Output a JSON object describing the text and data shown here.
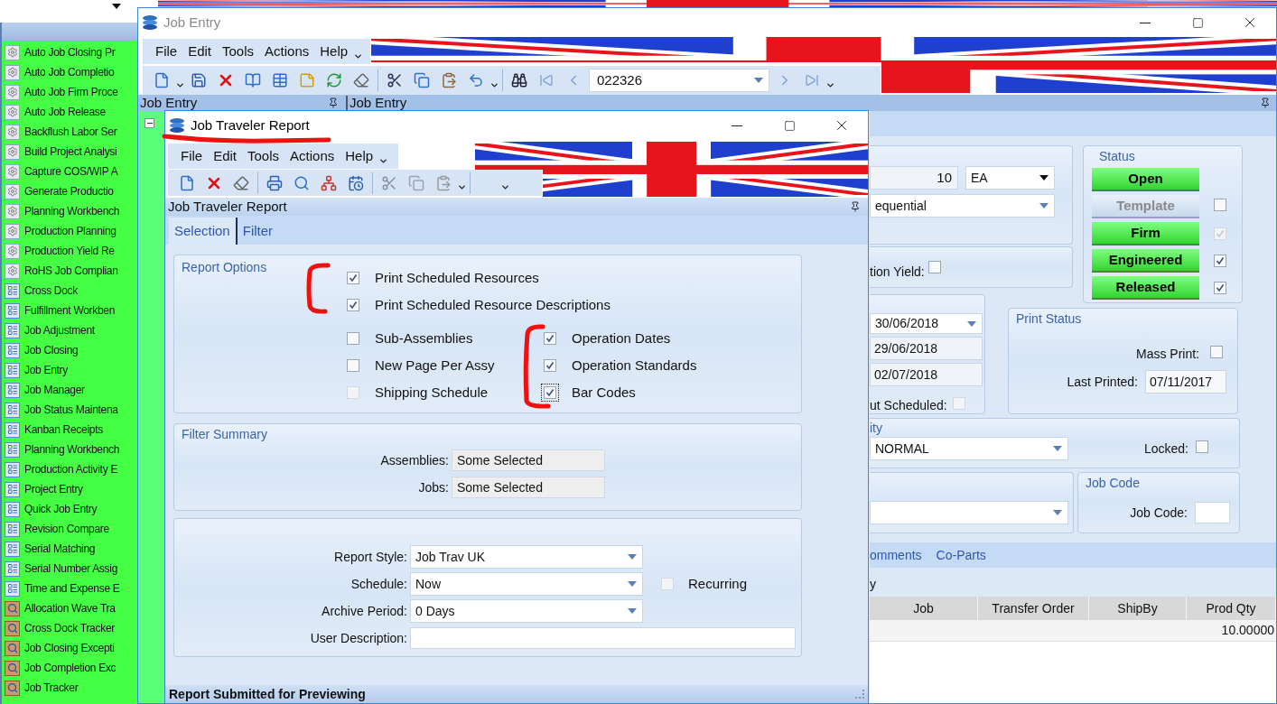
{
  "sidebar": {
    "items": [
      {
        "label": "Auto Job Closing Pr",
        "kind": "process"
      },
      {
        "label": "Auto Job Completio",
        "kind": "process"
      },
      {
        "label": "Auto Job Firm Proce",
        "kind": "process"
      },
      {
        "label": "Auto Job Release",
        "kind": "process"
      },
      {
        "label": "Backflush Labor Ser",
        "kind": "process"
      },
      {
        "label": "Build Project Analysi",
        "kind": "process"
      },
      {
        "label": "Capture COS/WIP A",
        "kind": "process"
      },
      {
        "label": "Generate Productio",
        "kind": "process"
      },
      {
        "label": "Planning Workbench",
        "kind": "process"
      },
      {
        "label": "Production Planning",
        "kind": "process"
      },
      {
        "label": "Production Yield Re",
        "kind": "process"
      },
      {
        "label": "RoHS Job Complian",
        "kind": "process"
      },
      {
        "label": "Cross Dock",
        "kind": "entry"
      },
      {
        "label": "Fulfillment Workben",
        "kind": "entry"
      },
      {
        "label": "Job Adjustment",
        "kind": "entry"
      },
      {
        "label": "Job Closing",
        "kind": "entry"
      },
      {
        "label": "Job Entry",
        "kind": "entry"
      },
      {
        "label": "Job Manager",
        "kind": "entry"
      },
      {
        "label": "Job Status Maintena",
        "kind": "entry"
      },
      {
        "label": "Kanban Receipts",
        "kind": "entry"
      },
      {
        "label": "Planning Workbench",
        "kind": "entry"
      },
      {
        "label": "Production Activity E",
        "kind": "entry"
      },
      {
        "label": "Project Entry",
        "kind": "entry"
      },
      {
        "label": "Quick Job Entry",
        "kind": "entry"
      },
      {
        "label": "Revision Compare",
        "kind": "entry"
      },
      {
        "label": "Serial Matching",
        "kind": "entry"
      },
      {
        "label": "Serial Number Assig",
        "kind": "entry"
      },
      {
        "label": "Time and Expense E",
        "kind": "entry"
      },
      {
        "label": "Allocation Wave Tra",
        "kind": "tracker"
      },
      {
        "label": "Cross Dock Tracker",
        "kind": "tracker"
      },
      {
        "label": "Job Closing Excepti",
        "kind": "tracker"
      },
      {
        "label": "Job Completion Exc",
        "kind": "tracker"
      },
      {
        "label": "Job Tracker",
        "kind": "tracker"
      }
    ]
  },
  "job_entry": {
    "title": "Job Entry",
    "menu": [
      "File",
      "Edit",
      "Tools",
      "Actions",
      "Help"
    ],
    "job_number": "022326",
    "pane_headers": [
      "Job Entry",
      "Job Entry"
    ],
    "quantity": "10",
    "uom": "EA",
    "scheduling": "equential",
    "yield": {
      "label": "tion Yield:",
      "checked": false
    },
    "dates": [
      "30/06/2018",
      "29/06/2018",
      "02/07/2018"
    ],
    "cut_scheduled": {
      "label": "ut Scheduled:",
      "checked": false,
      "disabled": true
    },
    "status": {
      "title": "Status",
      "buttons": [
        {
          "label": "Open",
          "active": true
        },
        {
          "label": "Template",
          "active": false,
          "checkbox": {
            "checked": false,
            "disabled": false
          }
        },
        {
          "label": "Firm",
          "active": true,
          "checkbox": {
            "checked": true,
            "disabled": true
          }
        },
        {
          "label": "Engineered",
          "active": true,
          "checkbox": {
            "checked": true,
            "disabled": false
          }
        },
        {
          "label": "Released",
          "active": true,
          "checkbox": {
            "checked": true,
            "disabled": false
          }
        }
      ]
    },
    "print_status": {
      "title": "Print Status",
      "mass_print": {
        "label": "Mass Print:",
        "checked": false
      },
      "last_printed_label": "Last Printed:",
      "last_printed": "07/11/2017"
    },
    "priority": {
      "title": "ity",
      "value": "NORMAL",
      "locked": {
        "label": "Locked:",
        "checked": false
      }
    },
    "job_code": {
      "title": "Job Code",
      "label": "Job Code:"
    },
    "tabs": [
      {
        "label": "omments",
        "selected": false
      },
      {
        "label": "Co-Parts",
        "selected": false
      }
    ],
    "grid": {
      "title": "y",
      "columns": [
        "Job",
        "Transfer Order",
        "ShipBy",
        "Prod Qty"
      ],
      "rows": [
        {
          "prod_qty": "10.00000"
        }
      ]
    }
  },
  "job_traveler": {
    "title": "Job Traveler Report",
    "menu": [
      "File",
      "Edit",
      "Tools",
      "Actions",
      "Help"
    ],
    "header": "Job Traveler Report",
    "tabs": [
      {
        "label": "Selection",
        "selected": true
      },
      {
        "label": "Filter",
        "selected": false
      }
    ],
    "report_options": {
      "title": "Report Options",
      "upper": [
        {
          "label": "Print Scheduled Resources",
          "checked": true,
          "disabled": false,
          "focused": false
        },
        {
          "label": "Print Scheduled Resource Descriptions",
          "checked": true,
          "disabled": false,
          "focused": false
        }
      ],
      "left": [
        {
          "label": "Sub-Assemblies",
          "checked": false,
          "disabled": false,
          "focused": false
        },
        {
          "label": "New Page Per Assy",
          "checked": false,
          "disabled": false,
          "focused": false
        },
        {
          "label": "Shipping Schedule",
          "checked": false,
          "disabled": true,
          "focused": false
        }
      ],
      "right": [
        {
          "label": "Operation Dates",
          "checked": true,
          "disabled": false,
          "focused": false
        },
        {
          "label": "Operation Standards",
          "checked": true,
          "disabled": false,
          "focused": false
        },
        {
          "label": "Bar Codes",
          "checked": true,
          "disabled": false,
          "focused": true
        }
      ]
    },
    "filter_summary": {
      "title": "Filter Summary",
      "fields": [
        {
          "label": "Assemblies:",
          "value": "Some Selected"
        },
        {
          "label": "Jobs:",
          "value": "Some Selected"
        }
      ]
    },
    "schedule": {
      "fields": [
        {
          "label": "Report Style:",
          "value": "Job Trav UK",
          "kind": "dropdown"
        },
        {
          "label": "Schedule:",
          "value": "Now",
          "kind": "dropdown"
        },
        {
          "label": "Archive Period:",
          "value": "0 Days",
          "kind": "dropdown"
        },
        {
          "label": "User Description:",
          "kind": "text"
        }
      ],
      "recurring": {
        "label": "Recurring",
        "checked": false,
        "disabled": true
      }
    },
    "status_bar": "Report Submitted for Previewing"
  }
}
